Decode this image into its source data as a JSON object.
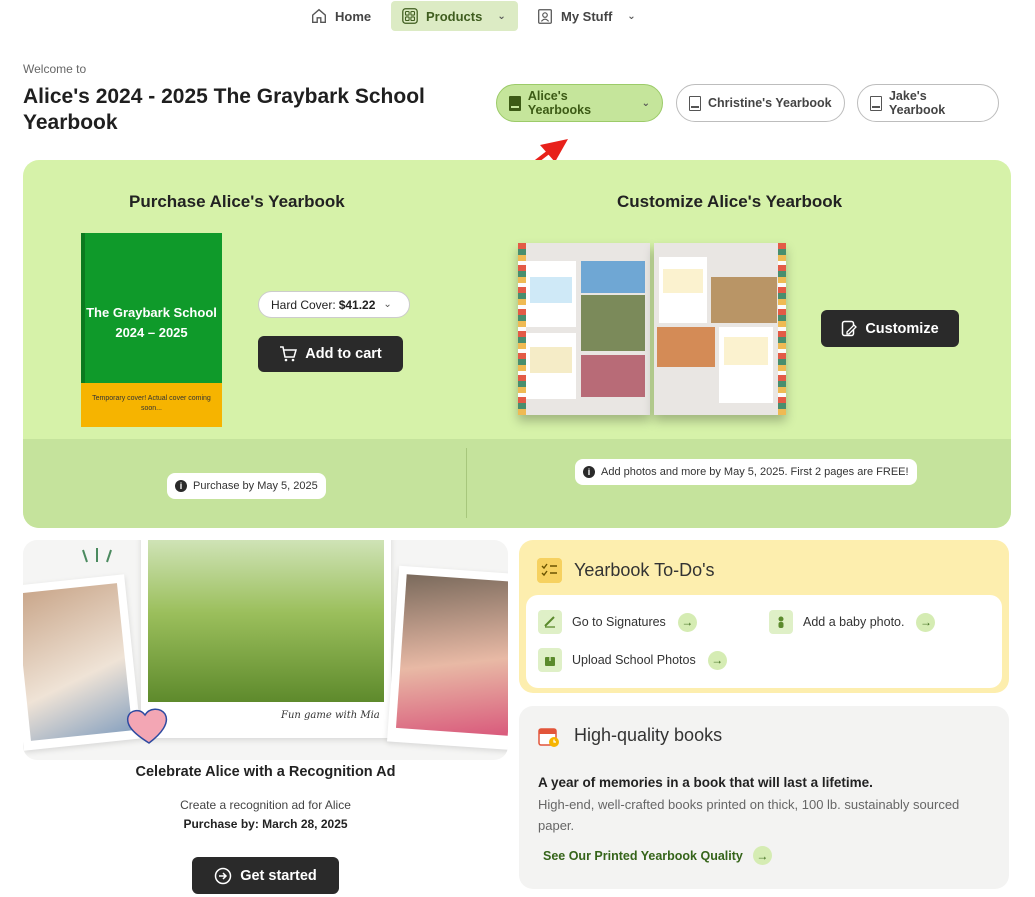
{
  "nav": {
    "home": "Home",
    "products": "Products",
    "my_stuff": "My Stuff"
  },
  "header": {
    "welcome": "Welcome to",
    "title": "Alice's 2024 - 2025 The Graybark School Yearbook"
  },
  "yearbooks": {
    "alice": "Alice's Yearbooks",
    "christine": "Christine's Yearbook",
    "jake": "Jake's Yearbook"
  },
  "purchase": {
    "heading": "Purchase Alice's Yearbook",
    "cover_title": "The Graybark School 2024 – 2025",
    "cover_note": "Temporary cover! Actual cover coming soon...",
    "cover_type": "Hard Cover:",
    "price": "$41.22",
    "add_to_cart": "Add to cart",
    "deadline": "Purchase by May 5, 2025"
  },
  "customize": {
    "heading": "Customize Alice's Yearbook",
    "button": "Customize",
    "note": "Add photos and more by May 5, 2025. First 2 pages are FREE!"
  },
  "ad": {
    "caption": "Fun game with Mia",
    "title": "Celebrate Alice with a Recognition Ad",
    "subtitle": "Create a recognition ad for Alice",
    "purchase_by": "Purchase by: March 28, 2025",
    "button": "Get started"
  },
  "todo": {
    "heading": "Yearbook To-Do's",
    "items": [
      {
        "label": "Go to Signatures"
      },
      {
        "label": "Add a baby photo."
      },
      {
        "label": "Upload School Photos"
      }
    ]
  },
  "quality": {
    "heading": "High-quality books",
    "bold": "A year of memories in a book that will last a lifetime.",
    "text": "High-end, well-crafted books printed on thick, 100 lb. sustainably sourced paper.",
    "link": "See Our Printed Yearbook Quality"
  },
  "colors": {
    "panel_green": "#d6f2a9",
    "panel_green_dark": "#c5e39c",
    "cover_green": "#0f9a2a",
    "cover_yellow": "#f6b400",
    "dark_button": "#2a2a2a",
    "arrow_red": "#e8211b",
    "todo_yellow": "#fdeeae"
  }
}
